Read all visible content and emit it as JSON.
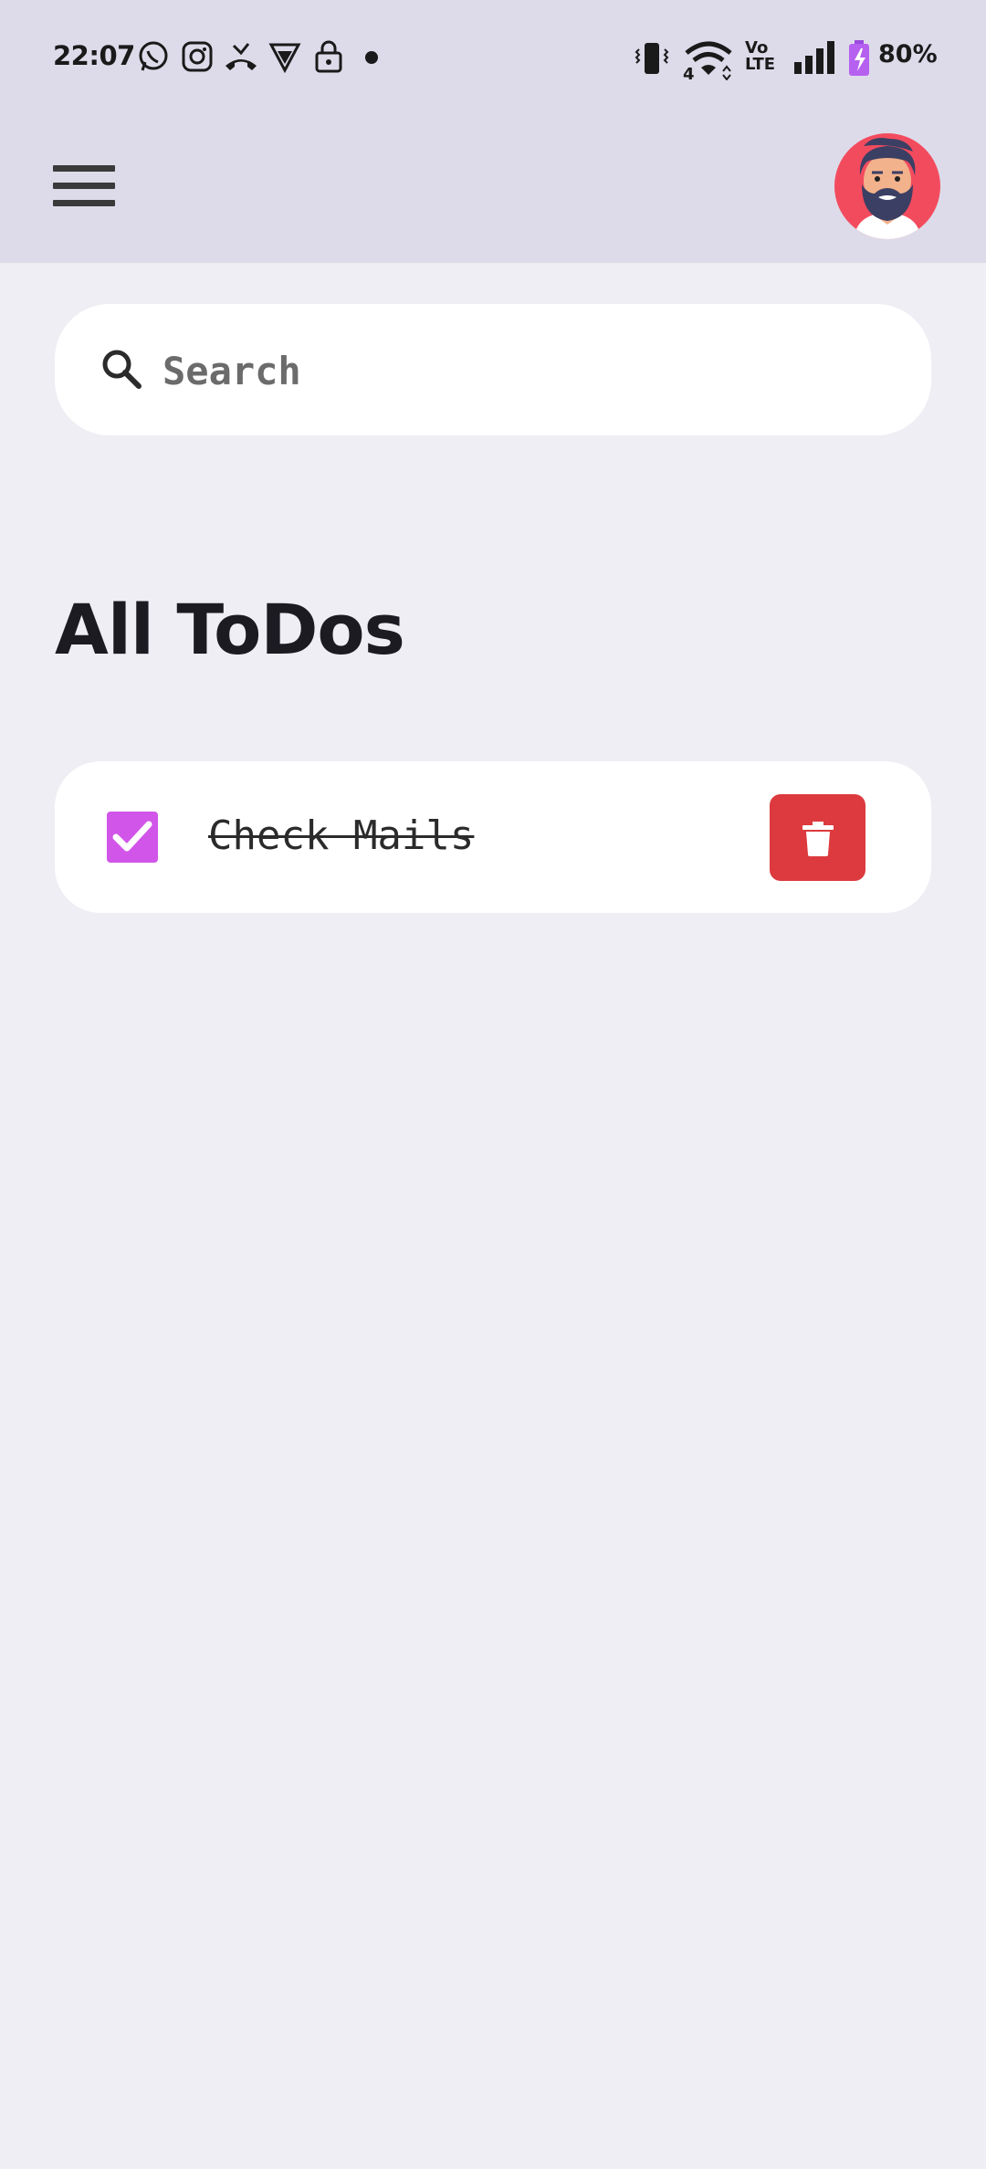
{
  "status_bar": {
    "time": "22:07",
    "battery": "80%",
    "icons": [
      "whatsapp-icon",
      "instagram-icon",
      "missed-call-icon",
      "vpn-shield-icon",
      "lock-icon",
      "dot-icon",
      "vibrate-icon",
      "wifi-icon",
      "volte-icon",
      "signal-icon",
      "battery-charging-icon"
    ],
    "volte_line1": "Vo",
    "volte_line2": "LTE",
    "wifi_badge": "4"
  },
  "app_bar": {
    "menu_icon": "hamburger-menu-icon",
    "avatar_icon": "bearded-man-avatar"
  },
  "search": {
    "placeholder": "Search",
    "value": ""
  },
  "main": {
    "title": "All ToDos",
    "todos": [
      {
        "label": "Check Mails",
        "done": true
      }
    ]
  },
  "colors": {
    "top_bar": "#DDDBE9",
    "background": "#EEEEF4",
    "checkbox": "#D155E8",
    "delete_button": "#DC3A3E",
    "avatar_bg": "#F34B5E"
  }
}
